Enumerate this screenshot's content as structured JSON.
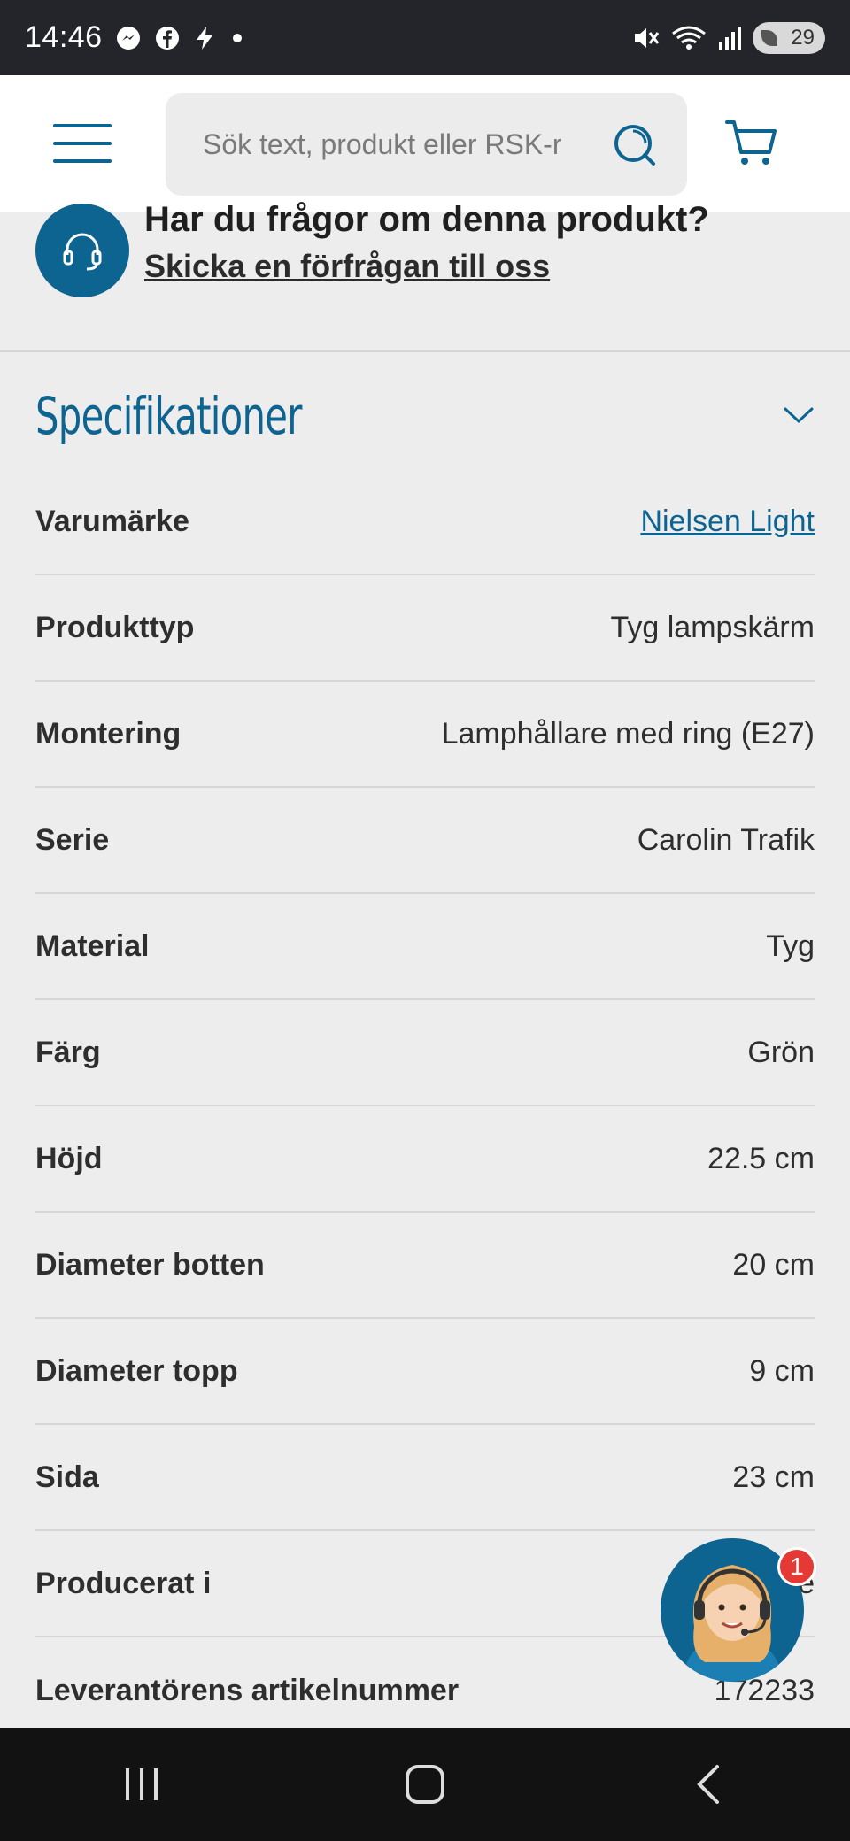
{
  "status_bar": {
    "time": "14:46",
    "battery": "29",
    "icons": [
      "messenger-icon",
      "facebook-icon",
      "charging-icon",
      "mute-icon",
      "wifi-icon",
      "signal-icon"
    ]
  },
  "header": {
    "search_placeholder": "Sök text, produkt eller RSK-r",
    "accent_color": "#0e6491"
  },
  "question": {
    "title": "Har du frågor om denna produkt?",
    "link": "Skicka en förfrågan till oss"
  },
  "specs": {
    "title": "Specifikationer",
    "rows": [
      {
        "label": "Varumärke",
        "value": "Nielsen Light"
      },
      {
        "label": "Produkttyp",
        "value": "Tyg lampskärm"
      },
      {
        "label": "Montering",
        "value": "Lamphållare med ring (E27)"
      },
      {
        "label": "Serie",
        "value": "Carolin Trafik"
      },
      {
        "label": "Material",
        "value": "Tyg"
      },
      {
        "label": "Färg",
        "value": "Grön"
      },
      {
        "label": "Höjd",
        "value": "22.5 cm"
      },
      {
        "label": "Diameter botten",
        "value": "20 cm"
      },
      {
        "label": "Diameter topp",
        "value": "9 cm"
      },
      {
        "label": "Sida",
        "value": "23 cm"
      },
      {
        "label": "Producerat i",
        "value": "...e"
      },
      {
        "label": "Leverantörens artikelnummer",
        "value": "172233"
      }
    ]
  },
  "chat": {
    "badge": "1"
  }
}
